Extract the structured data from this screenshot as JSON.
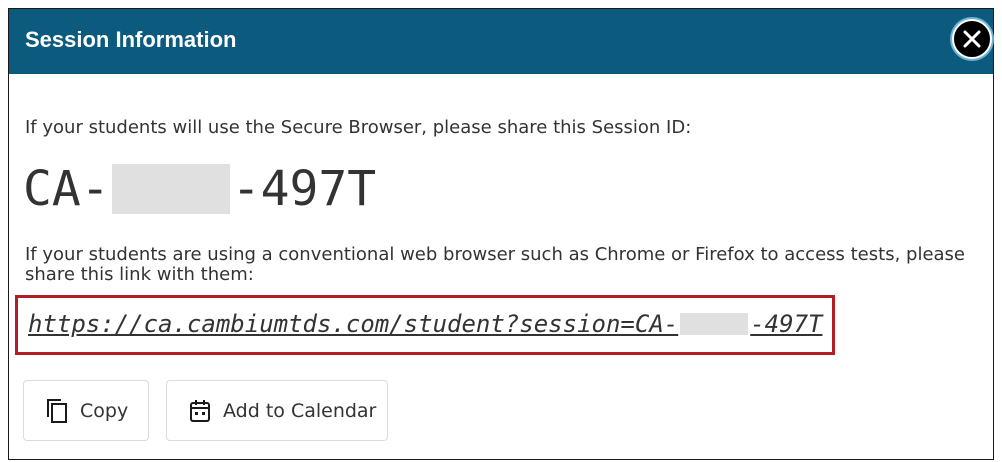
{
  "dialog": {
    "title": "Session Information",
    "close_icon": "close-icon"
  },
  "instructions": {
    "secure_browser": "If your students will use the Secure Browser, please share this Session ID:",
    "web_browser": "If your students are using a conventional web browser such as Chrome or Firefox to access tests, please share this link with them:"
  },
  "session": {
    "id_prefix": "CA-",
    "id_suffix": "-497T"
  },
  "link": {
    "prefix": "https://ca.cambiumtds.com/student?session=CA-",
    "suffix": "-497T"
  },
  "buttons": {
    "copy": {
      "label": "Copy",
      "icon": "copy-icon"
    },
    "calendar": {
      "label": "Add to Calendar",
      "icon": "calendar-icon"
    }
  },
  "colors": {
    "header_bg": "#0c5a7d",
    "highlight_border": "#b21e23",
    "redaction": "#e0e0e0"
  }
}
